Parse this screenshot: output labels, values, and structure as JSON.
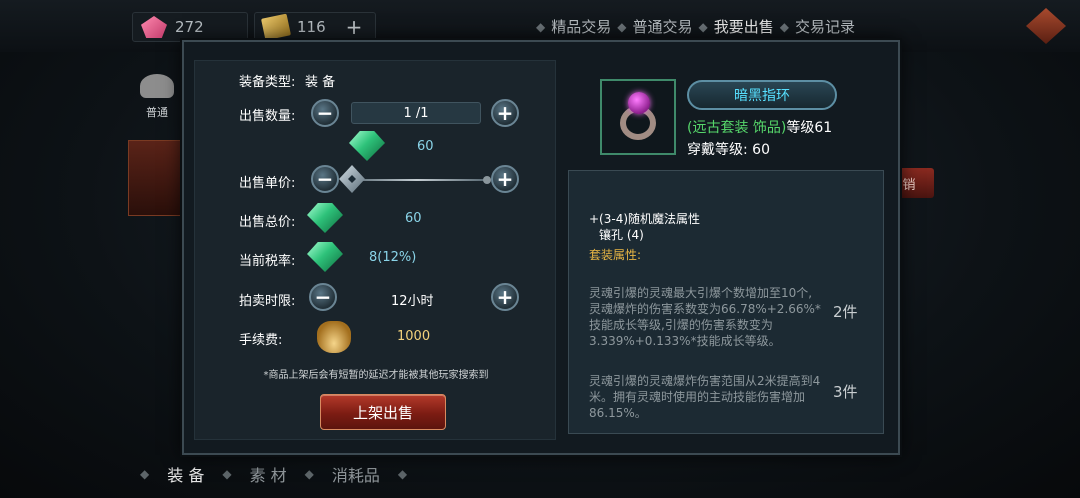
{
  "currencies": {
    "gems": "272",
    "tickets": "116",
    "tickets_add": "+"
  },
  "top_tabs": [
    {
      "label": "精品交易"
    },
    {
      "label": "普通交易"
    },
    {
      "label": "我要出售"
    },
    {
      "label": "交易记录"
    }
  ],
  "side": {
    "category_label": "普通",
    "right_button": "销"
  },
  "bottom_tabs": [
    {
      "label": "装 备"
    },
    {
      "label": "素 材"
    },
    {
      "label": "消耗品"
    }
  ],
  "sell_form": {
    "equip_type_label": "装备类型:",
    "equip_type_value": "装 备",
    "quantity_label": "出售数量:",
    "quantity_value": "1 /1",
    "unit_gem_value": "60",
    "unit_price_label": "出售单价:",
    "total_label": "出售总价:",
    "total_value": "60",
    "tax_label": "当前税率:",
    "tax_value": "8(12%)",
    "time_label": "拍卖时限:",
    "time_value": "12小时",
    "fee_label": "手续费:",
    "fee_value": "1000",
    "minus": "−",
    "plus": "+",
    "note": "*商品上架后会有短暂的延迟才能被其他玩家搜索到",
    "sell_button": "上架出售"
  },
  "item": {
    "name": "暗黑指环",
    "set_tag": "(远古套装 饰品)",
    "level": "等级61",
    "wear_level": "穿戴等级: 60",
    "attr_line": "+(3-4)随机魔法属性",
    "socket_line": "镶孔 (4)",
    "set_attr_title": "套装属性:",
    "set_bonus_2": "灵魂引爆的灵魂最大引爆个数增加至10个,灵魂爆炸的伤害系数变为66.78%+2.66%*技能成长等级,引爆的伤害系数变为3.339%+0.133%*技能成长等级。",
    "set_bonus_2_count": "2件",
    "set_bonus_3": "灵魂引爆的灵魂爆炸伤害范围从2米提高到4米。拥有灵魂时使用的主动技能伤害增加86.15%。",
    "set_bonus_3_count": "3件"
  },
  "colors": {
    "name_plate": "#57e0ff",
    "set_tag": "#56d66a",
    "set_title": "#e7b544",
    "sell_button": "#9a2a1c"
  }
}
